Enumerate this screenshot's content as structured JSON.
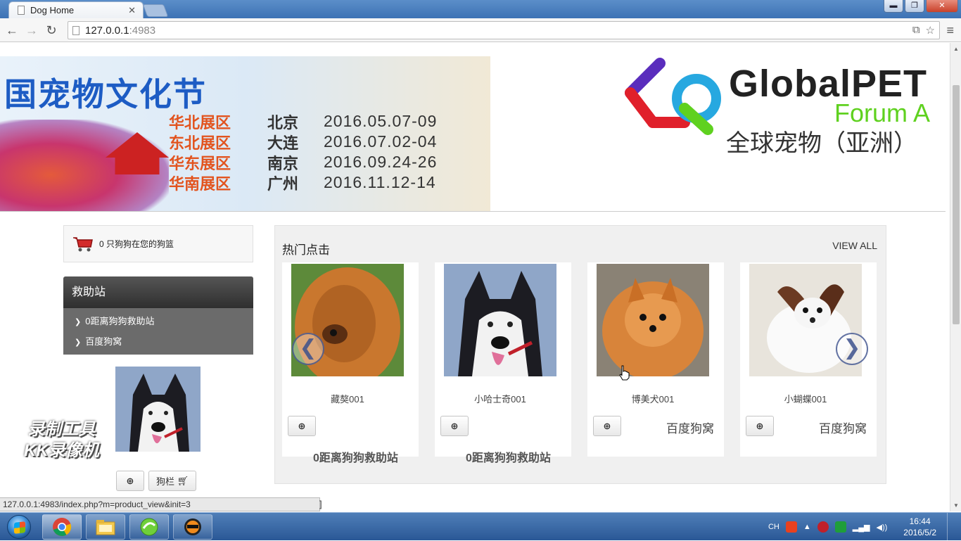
{
  "browser": {
    "tab_title": "Dog Home",
    "tab_close": "✕",
    "url_host": "127.0.0.1",
    "url_port": ":4983",
    "window_buttons": {
      "minimize": "▬",
      "restore": "❐",
      "close": "✕"
    }
  },
  "banner_left": {
    "headline": "国宠物文化节",
    "schedule": [
      {
        "region": "华北展区",
        "city": "北京",
        "date": "2016.05.07-09"
      },
      {
        "region": "东北展区",
        "city": "大连",
        "date": "2016.07.02-04"
      },
      {
        "region": "华东展区",
        "city": "南京",
        "date": "2016.09.24-26"
      },
      {
        "region": "华南展区",
        "city": "广州",
        "date": "2016.11.12-14"
      }
    ],
    "separator": "丨"
  },
  "banner_right": {
    "brand": "GlobalPET",
    "sub": "Forum A",
    "cn": "全球宠物（亚洲）"
  },
  "sidebar": {
    "cart_text": "0 只狗狗在您的狗篮",
    "rescue_title": "救助站",
    "rescue_items": [
      {
        "label": "0距离狗狗救助站"
      },
      {
        "label": "百度狗窝"
      }
    ],
    "kennel_button": "狗栏"
  },
  "watermark": {
    "line1": "录制工具",
    "line2": "KK录像机"
  },
  "hot": {
    "title": "热门点击",
    "view_all": "VIEW ALL",
    "prev": "❮",
    "next": "❯",
    "cards": [
      {
        "name": "藏獒001",
        "station": "0距离狗狗救助站",
        "kennel": ""
      },
      {
        "name": "小哈士奇001",
        "station": "0距离狗狗救助站",
        "kennel": ""
      },
      {
        "name": "博美犬001",
        "station": "",
        "kennel": "百度狗窝"
      },
      {
        "name": "小蝴蝶001",
        "station": "",
        "kennel": "百度狗窝"
      }
    ]
  },
  "status_bar": "127.0.0.1:4983/index.php?m=product_view&init=3",
  "page_bottom_fragment": "]",
  "taskbar": {
    "ime": "CH",
    "time": "16:44",
    "date": "2016/5/2"
  },
  "colors": {
    "accent_blue": "#1d5cc4",
    "region_orange": "#e2541f",
    "brand_green": "#5fd11f",
    "rescue_header": "#3a3a3a"
  },
  "icons": [
    "page-icon",
    "back-icon",
    "forward-icon",
    "reload-icon",
    "translate-icon",
    "star-icon",
    "menu-icon",
    "cart-icon",
    "chevron-right-icon",
    "zoom-icon",
    "cart-small-icon",
    "windows-orb-icon",
    "chrome-icon",
    "explorer-icon",
    "green-app-icon",
    "kk-recorder-icon",
    "sogou-icon",
    "network-icon",
    "volume-icon"
  ]
}
